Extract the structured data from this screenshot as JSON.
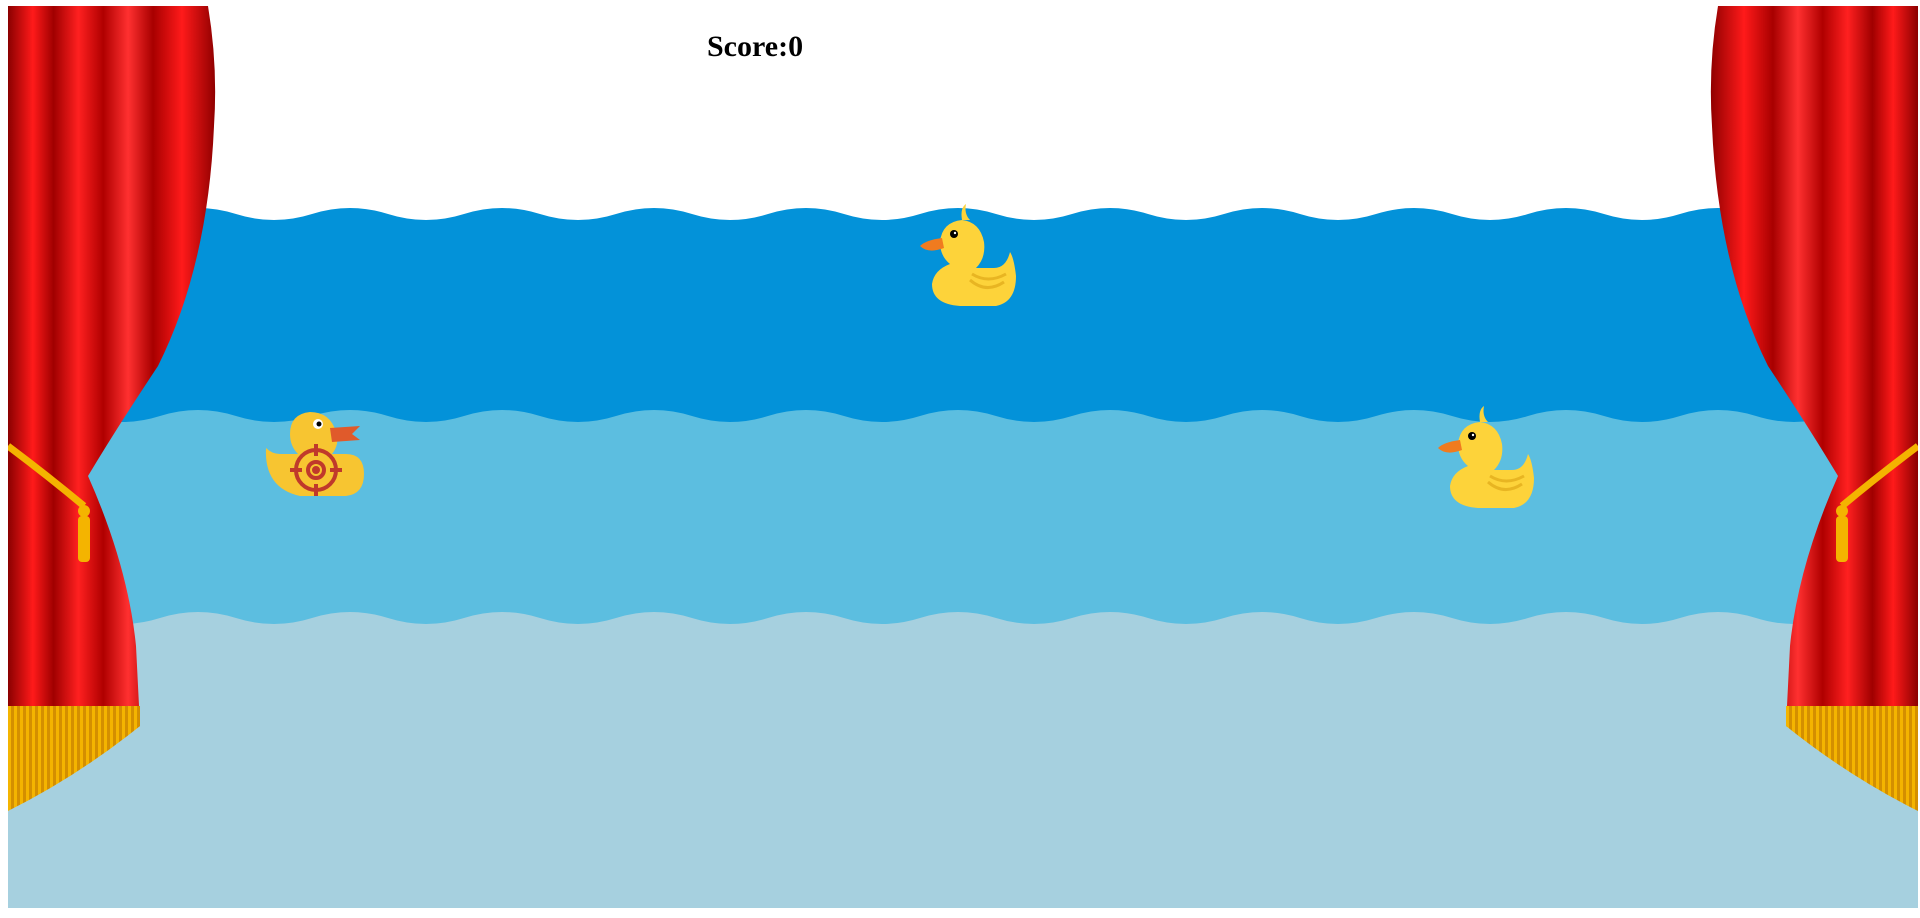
{
  "game": {
    "score_label": "Score:",
    "score_value": "0"
  },
  "colors": {
    "background": "#ffffff",
    "water_back": "#0392d9",
    "water_middle": "#5cbee0",
    "water_front": "#a6d0df",
    "duck_body": "#fdd33a",
    "duck_beak": "#f07b1f",
    "curtain_red": "#e00000",
    "curtain_fringe": "#f4b400",
    "crosshair": "#c0392b"
  },
  "icons": {
    "crosshair": "crosshair-icon",
    "duck": "rubber-duck-icon"
  }
}
